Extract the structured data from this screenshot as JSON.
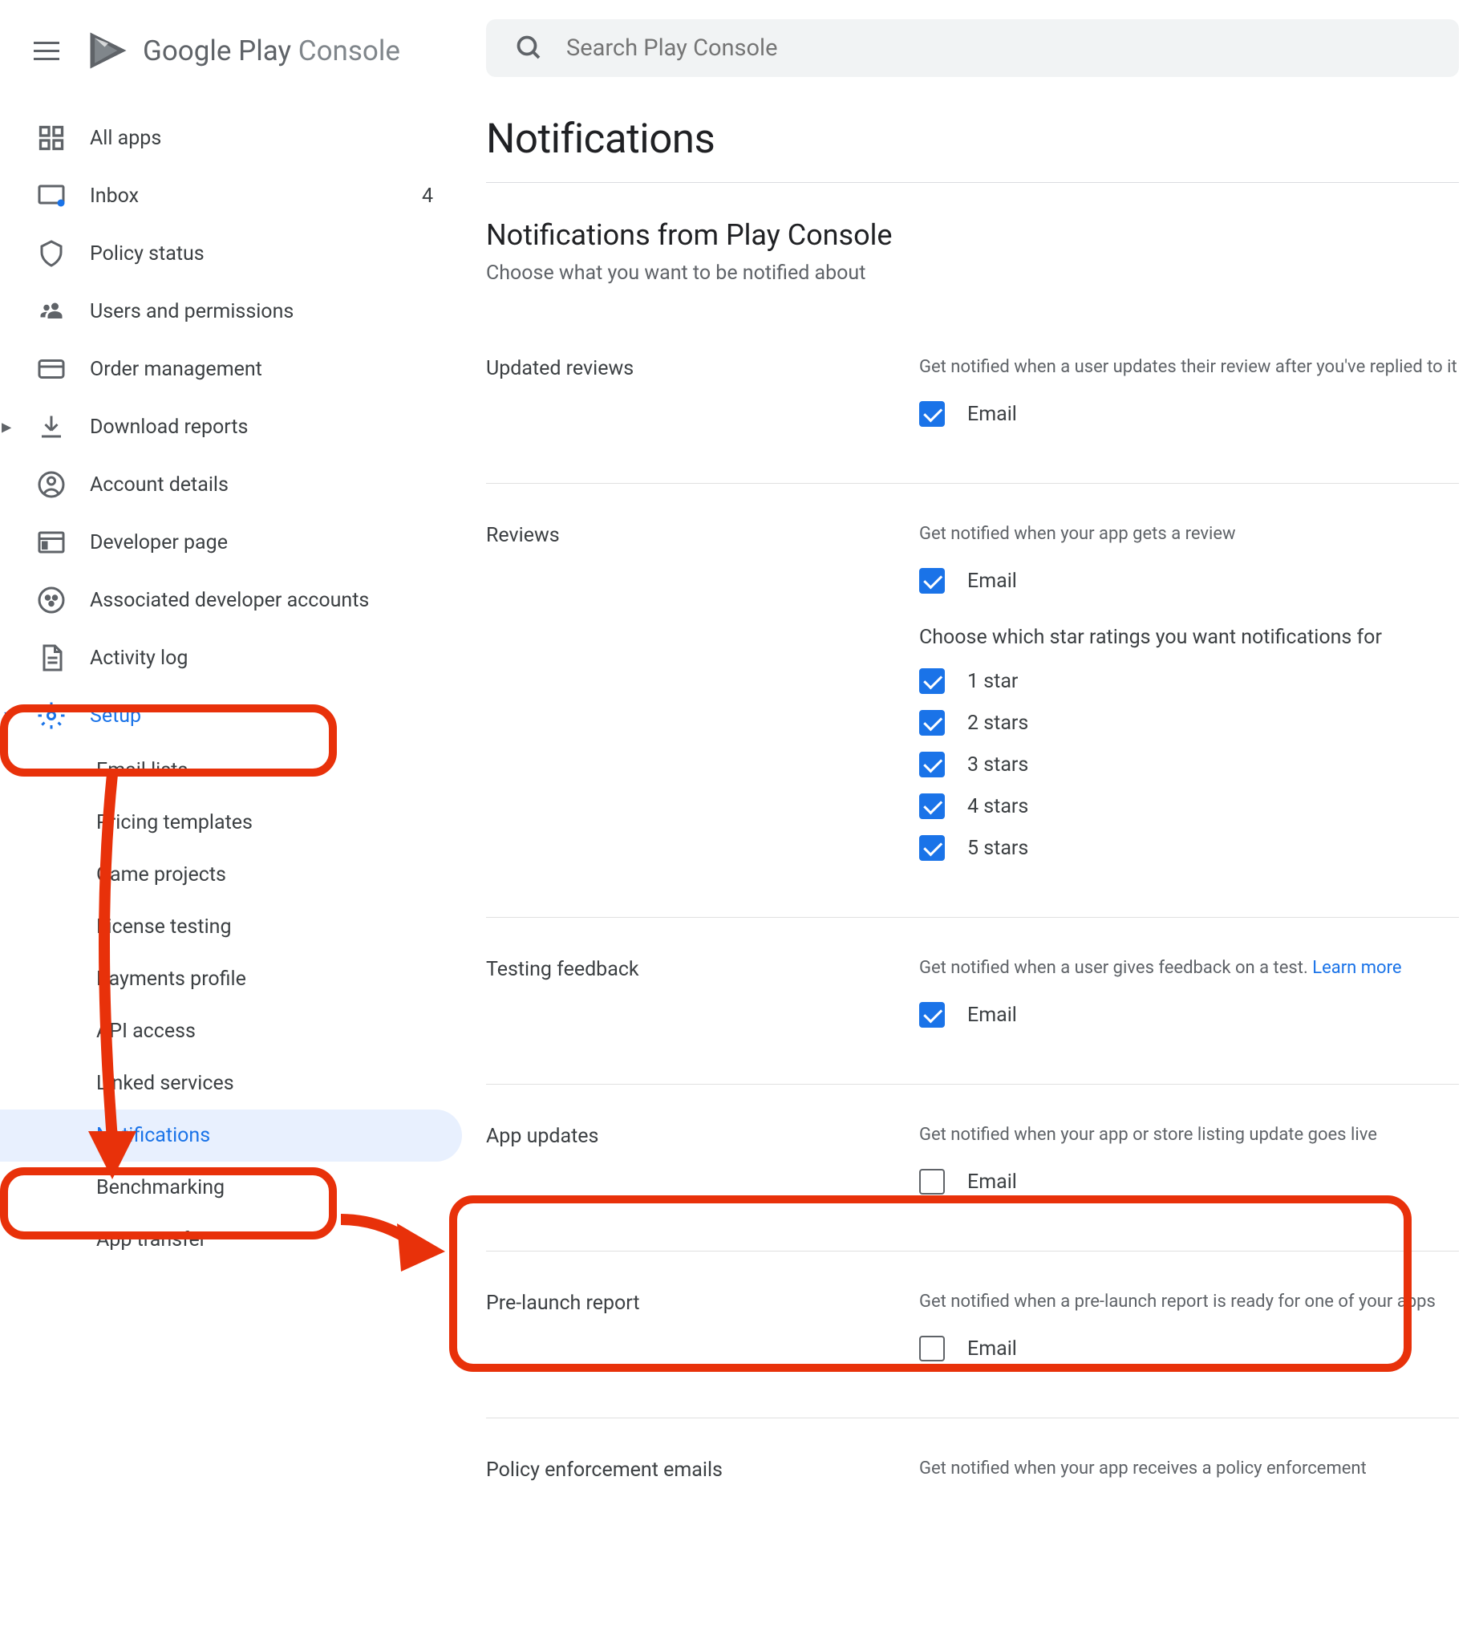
{
  "header": {
    "logo_play": "Google Play",
    "logo_console": "Console"
  },
  "search": {
    "placeholder": "Search Play Console"
  },
  "sidebar": {
    "all_apps": "All apps",
    "inbox": "Inbox",
    "inbox_count": "4",
    "policy_status": "Policy status",
    "users_permissions": "Users and permissions",
    "order_management": "Order management",
    "download_reports": "Download reports",
    "account_details": "Account details",
    "developer_page": "Developer page",
    "associated_accounts": "Associated developer accounts",
    "activity_log": "Activity log",
    "setup": "Setup",
    "email_lists": "Email lists",
    "pricing_templates": "Pricing templates",
    "game_projects": "Game projects",
    "license_testing": "License testing",
    "payments_profile": "Payments profile",
    "api_access": "API access",
    "linked_services": "Linked services",
    "notifications": "Notifications",
    "benchmarking": "Benchmarking",
    "app_transfer": "App transfer"
  },
  "page": {
    "title": "Notifications",
    "section_title": "Notifications from Play Console",
    "section_subtitle": "Choose what you want to be notified about",
    "email_label": "Email",
    "learn_more": "Learn more"
  },
  "settings": {
    "updated_reviews": {
      "label": "Updated reviews",
      "description": "Get notified when a user updates their review after you've replied to it",
      "email_checked": true
    },
    "reviews": {
      "label": "Reviews",
      "description": "Get notified when your app gets a review",
      "email_checked": true,
      "ratings_heading": "Choose which star ratings you want notifications for",
      "stars": [
        {
          "label": "1 star",
          "checked": true
        },
        {
          "label": "2 stars",
          "checked": true
        },
        {
          "label": "3 stars",
          "checked": true
        },
        {
          "label": "4 stars",
          "checked": true
        },
        {
          "label": "5 stars",
          "checked": true
        }
      ]
    },
    "testing_feedback": {
      "label": "Testing feedback",
      "description": "Get notified when a user gives feedback on a test.",
      "email_checked": true
    },
    "app_updates": {
      "label": "App updates",
      "description": "Get notified when your app or store listing update goes live",
      "email_checked": false
    },
    "prelaunch": {
      "label": "Pre-launch report",
      "description": "Get notified when a pre-launch report is ready for one of your apps",
      "email_checked": false
    },
    "policy_enforcement": {
      "label": "Policy enforcement emails",
      "description": "Get notified when your app receives a policy enforcement"
    }
  }
}
